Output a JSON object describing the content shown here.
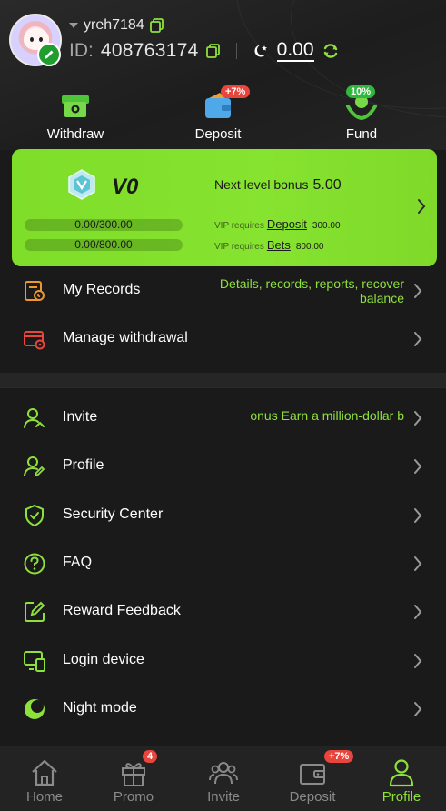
{
  "user": {
    "username": "yreh7184",
    "id_label": "ID:",
    "id_value": "408763174",
    "balance": "0.00"
  },
  "quick_actions": [
    {
      "label": "Withdraw",
      "icon": "withdraw-icon",
      "badge": ""
    },
    {
      "label": "Deposit",
      "icon": "deposit-icon",
      "badge": "+7%"
    },
    {
      "label": "Fund",
      "icon": "fund-icon",
      "badge": "10%"
    }
  ],
  "vip": {
    "level": "V0",
    "next_bonus_label": "Next level bonus",
    "next_bonus_value": "5.00",
    "deposit_progress": "0.00/300.00",
    "deposit_fraction": 0,
    "bets_progress": "0.00/800.00",
    "bets_fraction": 0,
    "req_prefix": "VIP requires",
    "deposit_link": "Deposit",
    "deposit_req": "300.00",
    "bets_link": "Bets",
    "bets_req": "800.00"
  },
  "menu_top": [
    {
      "label": "My Records",
      "icon": "records-icon",
      "extra_line1": "Details, records, reports, recover",
      "extra_line2": "balance"
    },
    {
      "label": "Manage withdrawal",
      "icon": "manage-withdrawal-icon"
    }
  ],
  "menu_main": [
    {
      "label": "Invite",
      "icon": "invite-icon",
      "extra": "onus  Earn a million-dollar b"
    },
    {
      "label": "Profile",
      "icon": "profile-icon"
    },
    {
      "label": "Security Center",
      "icon": "shield-icon"
    },
    {
      "label": "FAQ",
      "icon": "question-icon"
    },
    {
      "label": "Reward Feedback",
      "icon": "edit-icon"
    },
    {
      "label": "Login device",
      "icon": "devices-icon"
    },
    {
      "label": "Night mode",
      "icon": "moon-icon"
    }
  ],
  "bottom_nav": [
    {
      "label": "Home",
      "icon": "home-icon",
      "badge": ""
    },
    {
      "label": "Promo",
      "icon": "gift-icon",
      "badge": "4"
    },
    {
      "label": "Invite",
      "icon": "group-icon",
      "badge": ""
    },
    {
      "label": "Deposit",
      "icon": "wallet-icon",
      "badge": "+7%"
    },
    {
      "label": "Profile",
      "icon": "profile-icon",
      "badge": ""
    }
  ],
  "colors": {
    "accent": "#8ee03b",
    "vip_card": "#82df2c",
    "badge_red": "#e8453c",
    "background": "#1a1a1a"
  }
}
